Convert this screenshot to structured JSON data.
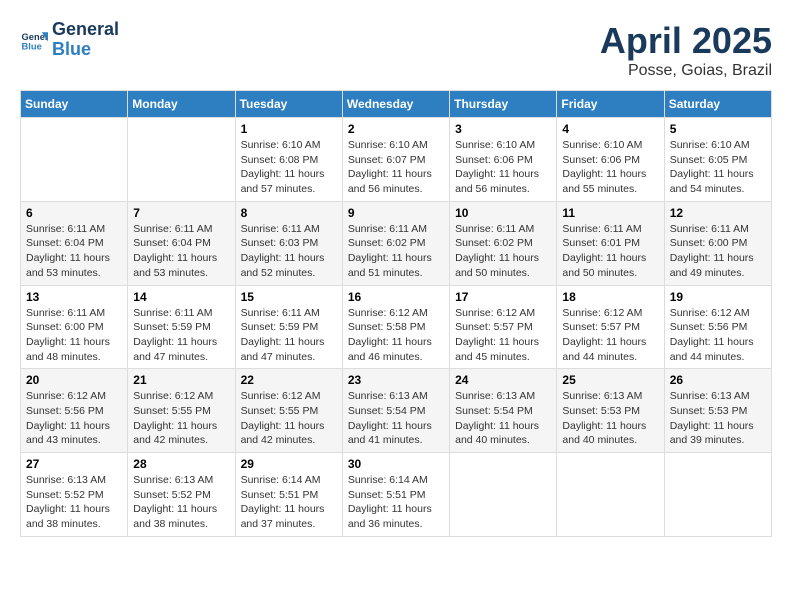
{
  "logo": {
    "line1": "General",
    "line2": "Blue"
  },
  "title": "April 2025",
  "subtitle": "Posse, Goias, Brazil",
  "headers": [
    "Sunday",
    "Monday",
    "Tuesday",
    "Wednesday",
    "Thursday",
    "Friday",
    "Saturday"
  ],
  "weeks": [
    [
      {
        "day": "",
        "info": ""
      },
      {
        "day": "",
        "info": ""
      },
      {
        "day": "1",
        "info": "Sunrise: 6:10 AM\nSunset: 6:08 PM\nDaylight: 11 hours and 57 minutes."
      },
      {
        "day": "2",
        "info": "Sunrise: 6:10 AM\nSunset: 6:07 PM\nDaylight: 11 hours and 56 minutes."
      },
      {
        "day": "3",
        "info": "Sunrise: 6:10 AM\nSunset: 6:06 PM\nDaylight: 11 hours and 56 minutes."
      },
      {
        "day": "4",
        "info": "Sunrise: 6:10 AM\nSunset: 6:06 PM\nDaylight: 11 hours and 55 minutes."
      },
      {
        "day": "5",
        "info": "Sunrise: 6:10 AM\nSunset: 6:05 PM\nDaylight: 11 hours and 54 minutes."
      }
    ],
    [
      {
        "day": "6",
        "info": "Sunrise: 6:11 AM\nSunset: 6:04 PM\nDaylight: 11 hours and 53 minutes."
      },
      {
        "day": "7",
        "info": "Sunrise: 6:11 AM\nSunset: 6:04 PM\nDaylight: 11 hours and 53 minutes."
      },
      {
        "day": "8",
        "info": "Sunrise: 6:11 AM\nSunset: 6:03 PM\nDaylight: 11 hours and 52 minutes."
      },
      {
        "day": "9",
        "info": "Sunrise: 6:11 AM\nSunset: 6:02 PM\nDaylight: 11 hours and 51 minutes."
      },
      {
        "day": "10",
        "info": "Sunrise: 6:11 AM\nSunset: 6:02 PM\nDaylight: 11 hours and 50 minutes."
      },
      {
        "day": "11",
        "info": "Sunrise: 6:11 AM\nSunset: 6:01 PM\nDaylight: 11 hours and 50 minutes."
      },
      {
        "day": "12",
        "info": "Sunrise: 6:11 AM\nSunset: 6:00 PM\nDaylight: 11 hours and 49 minutes."
      }
    ],
    [
      {
        "day": "13",
        "info": "Sunrise: 6:11 AM\nSunset: 6:00 PM\nDaylight: 11 hours and 48 minutes."
      },
      {
        "day": "14",
        "info": "Sunrise: 6:11 AM\nSunset: 5:59 PM\nDaylight: 11 hours and 47 minutes."
      },
      {
        "day": "15",
        "info": "Sunrise: 6:11 AM\nSunset: 5:59 PM\nDaylight: 11 hours and 47 minutes."
      },
      {
        "day": "16",
        "info": "Sunrise: 6:12 AM\nSunset: 5:58 PM\nDaylight: 11 hours and 46 minutes."
      },
      {
        "day": "17",
        "info": "Sunrise: 6:12 AM\nSunset: 5:57 PM\nDaylight: 11 hours and 45 minutes."
      },
      {
        "day": "18",
        "info": "Sunrise: 6:12 AM\nSunset: 5:57 PM\nDaylight: 11 hours and 44 minutes."
      },
      {
        "day": "19",
        "info": "Sunrise: 6:12 AM\nSunset: 5:56 PM\nDaylight: 11 hours and 44 minutes."
      }
    ],
    [
      {
        "day": "20",
        "info": "Sunrise: 6:12 AM\nSunset: 5:56 PM\nDaylight: 11 hours and 43 minutes."
      },
      {
        "day": "21",
        "info": "Sunrise: 6:12 AM\nSunset: 5:55 PM\nDaylight: 11 hours and 42 minutes."
      },
      {
        "day": "22",
        "info": "Sunrise: 6:12 AM\nSunset: 5:55 PM\nDaylight: 11 hours and 42 minutes."
      },
      {
        "day": "23",
        "info": "Sunrise: 6:13 AM\nSunset: 5:54 PM\nDaylight: 11 hours and 41 minutes."
      },
      {
        "day": "24",
        "info": "Sunrise: 6:13 AM\nSunset: 5:54 PM\nDaylight: 11 hours and 40 minutes."
      },
      {
        "day": "25",
        "info": "Sunrise: 6:13 AM\nSunset: 5:53 PM\nDaylight: 11 hours and 40 minutes."
      },
      {
        "day": "26",
        "info": "Sunrise: 6:13 AM\nSunset: 5:53 PM\nDaylight: 11 hours and 39 minutes."
      }
    ],
    [
      {
        "day": "27",
        "info": "Sunrise: 6:13 AM\nSunset: 5:52 PM\nDaylight: 11 hours and 38 minutes."
      },
      {
        "day": "28",
        "info": "Sunrise: 6:13 AM\nSunset: 5:52 PM\nDaylight: 11 hours and 38 minutes."
      },
      {
        "day": "29",
        "info": "Sunrise: 6:14 AM\nSunset: 5:51 PM\nDaylight: 11 hours and 37 minutes."
      },
      {
        "day": "30",
        "info": "Sunrise: 6:14 AM\nSunset: 5:51 PM\nDaylight: 11 hours and 36 minutes."
      },
      {
        "day": "",
        "info": ""
      },
      {
        "day": "",
        "info": ""
      },
      {
        "day": "",
        "info": ""
      }
    ]
  ]
}
